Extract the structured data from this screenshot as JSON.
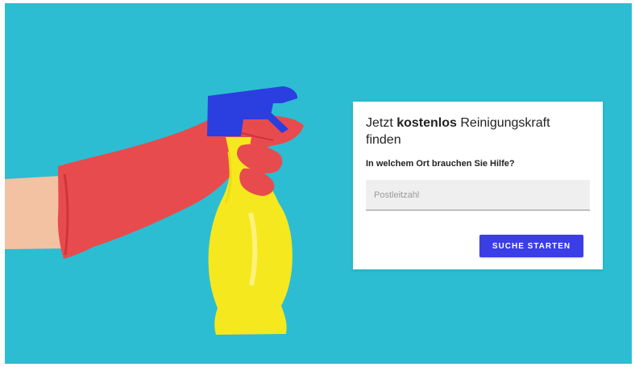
{
  "card": {
    "title_prefix": "Jetzt ",
    "title_emphasis": "kostenlos",
    "title_suffix": " Reinigungskraft finden",
    "question": "In welchem Ort brauchen Sie Hilfe?",
    "zip_placeholder": "Postleitzahl",
    "zip_value": "",
    "search_button_label": "SUCHE STARTEN"
  },
  "colors": {
    "hero_background": "#2cbdd2",
    "glove": "#e84b4d",
    "bottle": "#f6e81f",
    "sprayer": "#2b3ee0",
    "button": "#3b3de7"
  },
  "icons": {
    "illustration": "hand-in-glove-holding-spray-bottle"
  }
}
